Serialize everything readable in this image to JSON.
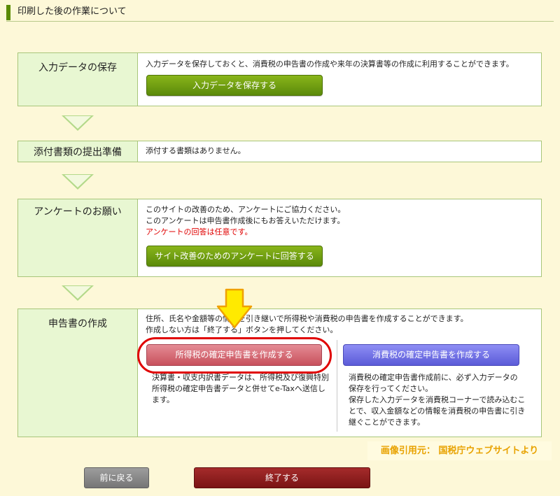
{
  "header": {
    "title": "印刷した後の作業について"
  },
  "panels": {
    "save": {
      "label": "入力データの保存",
      "text": "入力データを保存しておくと、消費税の申告書の作成や来年の決算書等の作成に利用することができます。",
      "button": "入力データを保存する"
    },
    "attach": {
      "label": "添付書類の提出準備",
      "text": "添付する書類はありません。"
    },
    "survey": {
      "label": "アンケートのお願い",
      "line1": "このサイトの改善のため、アンケートにご協力ください。",
      "line2": "このアンケートは申告書作成後にもお答えいただけます。",
      "line3": "アンケートの回答は任意です。",
      "button": "サイト改善のためのアンケートに回答する"
    },
    "create": {
      "label": "申告書の作成",
      "line1": "住所、氏名や金額等の情報を引き継いで所得税や消費税の申告書を作成することができます。",
      "line2": "作成しない方は「終了する」ボタンを押してください。",
      "income_button": "所得税の確定申告書を作成する",
      "income_desc": [
        "決算書・収支内訳書データは、所得税及び復興特別",
        "所得税の確定申告書データと併せてe-Taxへ送信し",
        "ます。"
      ],
      "consumption_button": "消費税の確定申告書を作成する",
      "consumption_desc": [
        "消費税の確定申告書作成前に、必ず入力データの",
        "保存を行ってください。",
        "保存した入力データを消費税コーナーで読み込むこ",
        "とで、収入金額などの情報を消費税の申告書に引き",
        "継ぐことができます。"
      ]
    }
  },
  "credit": "画像引用元： 国税庁ウェブサイトより",
  "nav": {
    "back": "前に戻る",
    "finish": "終了する"
  },
  "colors": {
    "accent_green": "#5b8a0a",
    "highlight_red": "#e00000",
    "arrow_yellow": "#ffea00"
  }
}
